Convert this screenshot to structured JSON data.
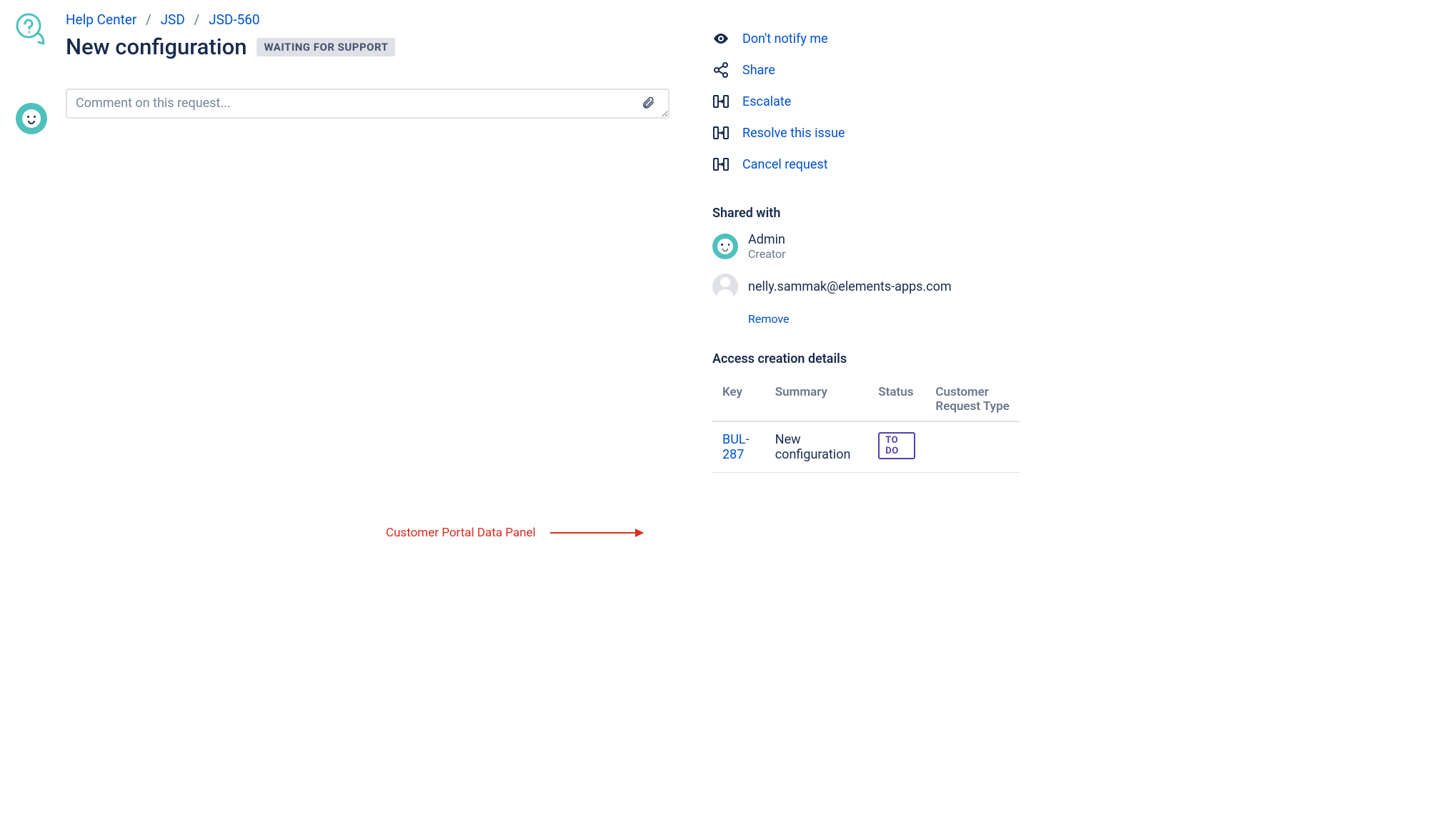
{
  "breadcrumb": {
    "help_center": "Help Center",
    "project": "JSD",
    "key": "JSD-560"
  },
  "header": {
    "title": "New configuration",
    "status": "WAITING FOR SUPPORT"
  },
  "comment": {
    "placeholder": "Comment on this request..."
  },
  "actions": {
    "notify": "Don't notify me",
    "share": "Share",
    "escalate": "Escalate",
    "resolve": "Resolve this issue",
    "cancel": "Cancel request"
  },
  "shared_with": {
    "heading": "Shared with",
    "creator": {
      "name": "Admin",
      "role": "Creator"
    },
    "participant": {
      "email": "nelly.sammak@elements-apps.com",
      "remove": "Remove"
    }
  },
  "details": {
    "heading": "Access creation details",
    "columns": {
      "key": "Key",
      "summary": "Summary",
      "status": "Status",
      "request_type": "Customer Request Type"
    },
    "row": {
      "key": "BUL-287",
      "summary": "New configuration",
      "status": "TO DO",
      "request_type": ""
    }
  },
  "annotation": {
    "label": "Customer Portal Data Panel"
  }
}
